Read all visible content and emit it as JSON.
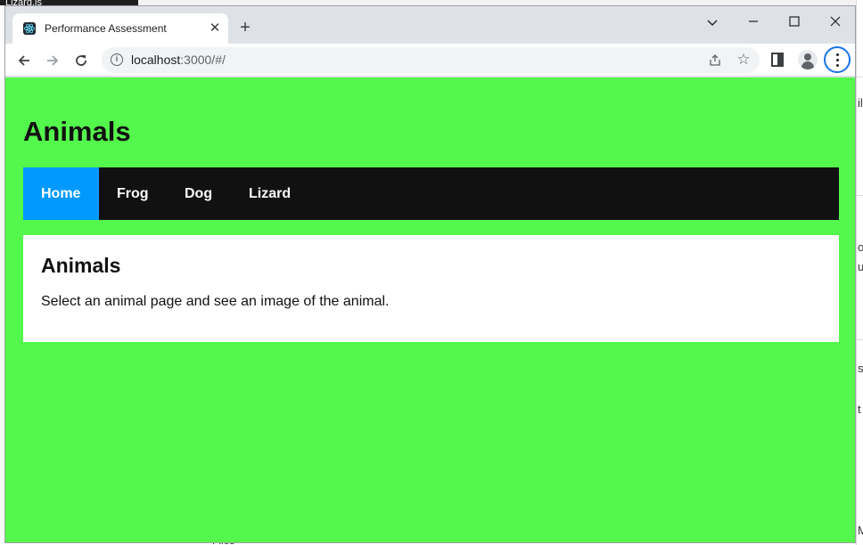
{
  "background": {
    "editor_tab_label": "Lizard.js",
    "right_fragments": [
      "il",
      "o",
      "ur",
      "s",
      "t",
      "Mi"
    ],
    "bottom_fragment": "Files"
  },
  "browser": {
    "tab_title": "Performance Assessment",
    "tab_close": "✕",
    "new_tab": "+",
    "url_host": "localhost",
    "url_rest": ":3000/#/",
    "controls": {
      "dropdown": "⌄",
      "minimize": "—",
      "maximize": "☐",
      "close": "✕"
    }
  },
  "page": {
    "site_title": "Animals",
    "nav": [
      {
        "label": "Home",
        "active": true
      },
      {
        "label": "Frog",
        "active": false
      },
      {
        "label": "Dog",
        "active": false
      },
      {
        "label": "Lizard",
        "active": false
      }
    ],
    "content": {
      "heading": "Animals",
      "text": "Select an animal page and see an image of the animal."
    }
  },
  "colors": {
    "page_background": "#54f74b",
    "nav_background": "#111111",
    "nav_active": "#0099ff",
    "focus_ring": "#1a73e8"
  }
}
